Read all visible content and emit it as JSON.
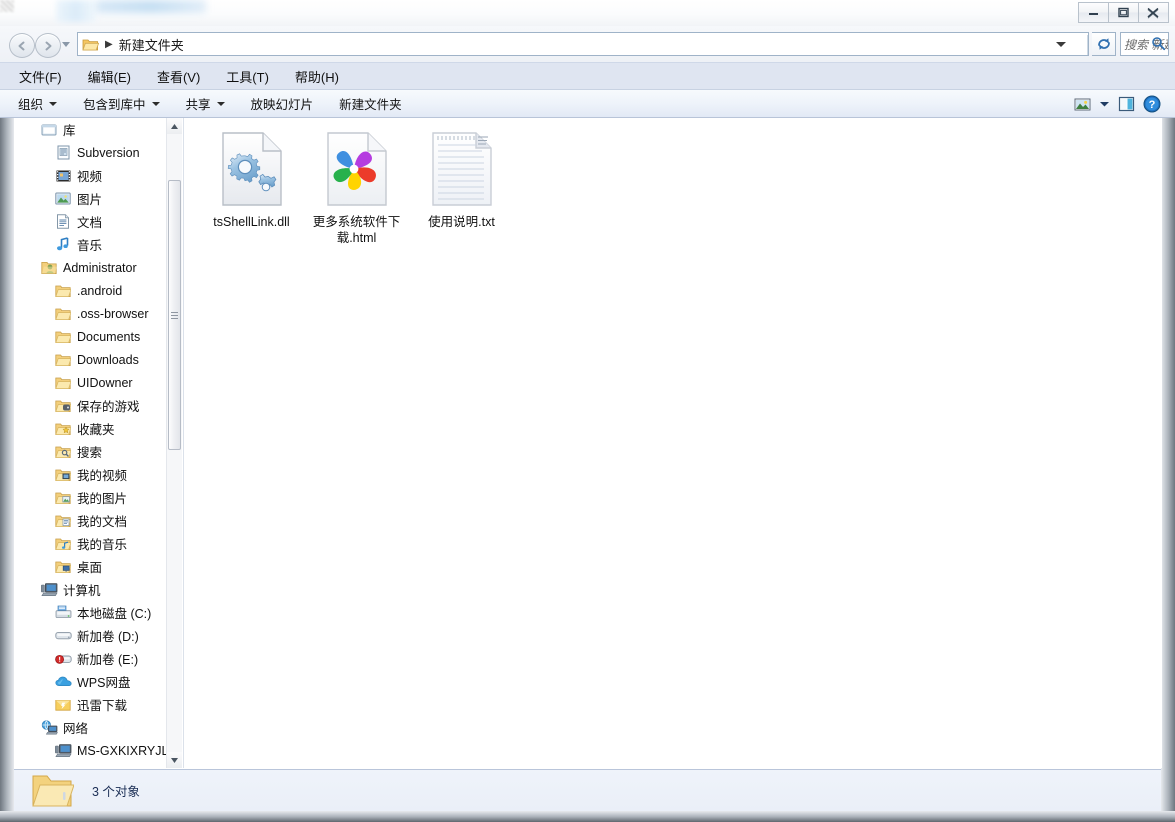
{
  "window": {
    "controls": [
      {
        "name": "minimize",
        "glyph": "minimize-icon"
      },
      {
        "name": "maximize",
        "glyph": "maximize-icon"
      },
      {
        "name": "close",
        "glyph": "close-icon"
      }
    ]
  },
  "address": {
    "back_tooltip": "后退",
    "forward_tooltip": "前进",
    "folder_icon": "folder-icon",
    "separator": "▶",
    "path": "新建文件夹",
    "refresh_icon": "refresh-icon"
  },
  "search": {
    "placeholder": "搜索 新建...",
    "icon": "search-icon"
  },
  "menu": {
    "items": [
      {
        "label": "文件(F)"
      },
      {
        "label": "编辑(E)"
      },
      {
        "label": "查看(V)"
      },
      {
        "label": "工具(T)"
      },
      {
        "label": "帮助(H)"
      }
    ]
  },
  "toolbar": {
    "items": [
      {
        "label": "组织",
        "has_caret": true
      },
      {
        "label": "包含到库中",
        "has_caret": true
      },
      {
        "label": "共享",
        "has_caret": true
      },
      {
        "label": "放映幻灯片",
        "has_caret": false
      },
      {
        "label": "新建文件夹",
        "has_caret": false
      }
    ],
    "right_icons": [
      {
        "name": "view-mode-icon"
      },
      {
        "name": "chevron-down-icon"
      },
      {
        "name": "preview-pane-icon"
      },
      {
        "name": "help-icon"
      }
    ]
  },
  "sidebar": {
    "items": [
      {
        "label": "库",
        "icon": "library-icon",
        "level": 0
      },
      {
        "label": "Subversion",
        "icon": "subversion-icon",
        "level": 1
      },
      {
        "label": "视频",
        "icon": "video-icon",
        "level": 1
      },
      {
        "label": "图片",
        "icon": "pictures-icon",
        "level": 1
      },
      {
        "label": "文档",
        "icon": "documents-icon",
        "level": 1
      },
      {
        "label": "音乐",
        "icon": "music-icon",
        "level": 1
      },
      {
        "label": "Administrator",
        "icon": "user-icon",
        "level": 0
      },
      {
        "label": ".android",
        "icon": "folder-icon",
        "level": 1
      },
      {
        "label": ".oss-browser",
        "icon": "folder-icon",
        "level": 1
      },
      {
        "label": "Documents",
        "icon": "folder-icon",
        "level": 1
      },
      {
        "label": "Downloads",
        "icon": "folder-icon",
        "level": 1
      },
      {
        "label": "UIDowner",
        "icon": "folder-icon",
        "level": 1
      },
      {
        "label": "保存的游戏",
        "icon": "saved-games-icon",
        "level": 1
      },
      {
        "label": "收藏夹",
        "icon": "favorites-icon",
        "level": 1
      },
      {
        "label": "搜索",
        "icon": "searches-icon",
        "level": 1
      },
      {
        "label": "我的视频",
        "icon": "my-video-icon",
        "level": 1
      },
      {
        "label": "我的图片",
        "icon": "my-pictures-icon",
        "level": 1
      },
      {
        "label": "我的文档",
        "icon": "my-documents-icon",
        "level": 1
      },
      {
        "label": "我的音乐",
        "icon": "my-music-icon",
        "level": 1
      },
      {
        "label": "桌面",
        "icon": "desktop-icon",
        "level": 1
      },
      {
        "label": "计算机",
        "icon": "computer-icon",
        "level": 0
      },
      {
        "label": "本地磁盘 (C:)",
        "icon": "system-drive-icon",
        "level": 1
      },
      {
        "label": "新加卷 (D:)",
        "icon": "drive-icon",
        "level": 1
      },
      {
        "label": "新加卷 (E:)",
        "icon": "drive-full-icon",
        "level": 1
      },
      {
        "label": "WPS网盘",
        "icon": "cloud-icon",
        "level": 1
      },
      {
        "label": "迅雷下载",
        "icon": "thunder-folder-icon",
        "level": 1
      },
      {
        "label": "网络",
        "icon": "network-icon",
        "level": 0
      },
      {
        "label": "MS-GXKIXRYJLV",
        "icon": "computer-icon",
        "level": 1
      }
    ],
    "scrollbar": {
      "up_arrow": "scroll-up-icon",
      "down_arrow": "scroll-down-icon"
    }
  },
  "files": [
    {
      "name": "tsShellLink.dll",
      "icon": "dll-gears-icon"
    },
    {
      "name": "更多系统软件下载.html",
      "icon": "html-pinwheel-icon"
    },
    {
      "name": "使用说明.txt",
      "icon": "txt-notepad-icon"
    }
  ],
  "status": {
    "icon": "open-folder-icon",
    "text": "3 个对象"
  },
  "colors": {
    "menubar": "#dfe5f1",
    "toolbar_top": "#f7fafd",
    "content_bg": "#ffffff",
    "status_bg": "#eff3fa",
    "text": "#111111",
    "status_text": "#1b2e55",
    "frame": "#6f7780"
  }
}
